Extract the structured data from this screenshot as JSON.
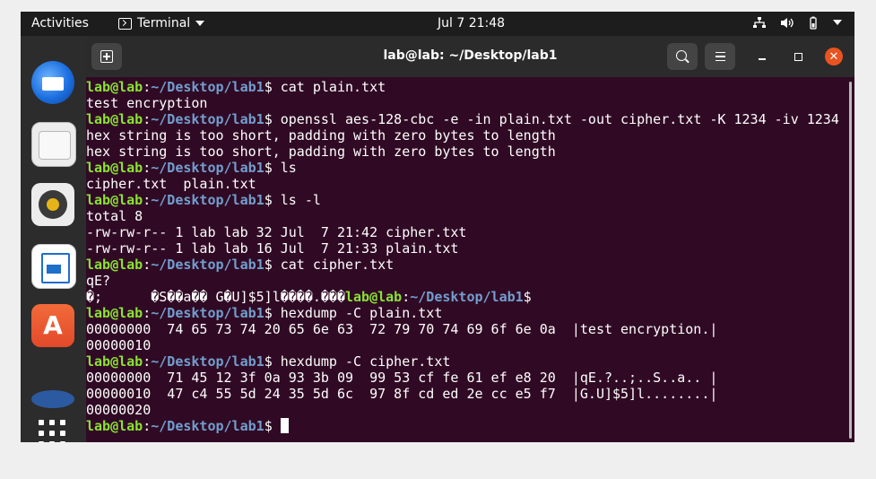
{
  "topbar": {
    "activities": "Activities",
    "app_name": "Terminal",
    "clock": "Jul 7  21:48",
    "icons": [
      "network-icon",
      "volume-icon",
      "battery-icon",
      "system-menu-icon"
    ]
  },
  "dock": {
    "apps": [
      "thunderbird-icon",
      "files-icon",
      "rhythmbox-icon",
      "libreoffice-impress-icon",
      "software-store-icon",
      "help-icon"
    ],
    "show_apps_icon": "app-grid-icon"
  },
  "window": {
    "title": "lab@lab: ~/Desktop/lab1"
  },
  "terminal": {
    "user": "lab@lab",
    "path": "~/Desktop/lab1",
    "lines": [
      {
        "cmd": " cat plain.txt"
      },
      {
        "out": "test encryption"
      },
      {
        "cmd": " openssl aes-128-cbc -e -in plain.txt -out cipher.txt -K 1234 -iv 1234"
      },
      {
        "out": "hex string is too short, padding with zero bytes to length"
      },
      {
        "out": "hex string is too short, padding with zero bytes to length"
      },
      {
        "cmd": " ls"
      },
      {
        "out": "cipher.txt  plain.txt"
      },
      {
        "cmd": " ls -l"
      },
      {
        "out": "total 8"
      },
      {
        "out": "-rw-rw-r-- 1 lab lab 32 Jul  7 21:42 cipher.txt"
      },
      {
        "out": "-rw-rw-r-- 1 lab lab 16 Jul  7 21:33 plain.txt"
      },
      {
        "cmd": " cat cipher.txt"
      },
      {
        "out": "qE?"
      },
      {
        "garbage": "�;      �S��a�� G�U]$5]l����.���",
        "cmd": ""
      },
      {
        "cmd": " hexdump -C plain.txt"
      },
      {
        "out": "00000000  74 65 73 74 20 65 6e 63  72 79 70 74 69 6f 6e 0a  |test encryption.|"
      },
      {
        "out": "00000010"
      },
      {
        "cmd": " hexdump -C cipher.txt"
      },
      {
        "out": "00000000  71 45 12 3f 0a 93 3b 09  99 53 cf fe 61 ef e8 20  |qE.?..;..S..a.. |"
      },
      {
        "out": "00000010  47 c4 55 5d 24 35 5d 6c  97 8f cd ed 2e cc e5 f7  |G.U]$5]l........|"
      },
      {
        "out": "00000020"
      },
      {
        "cmd": " ",
        "cursor": true
      }
    ]
  },
  "colors": {
    "terminal_bg": "#300a24",
    "user": "#8ae234",
    "path": "#729fcf",
    "close": "#e95420"
  }
}
